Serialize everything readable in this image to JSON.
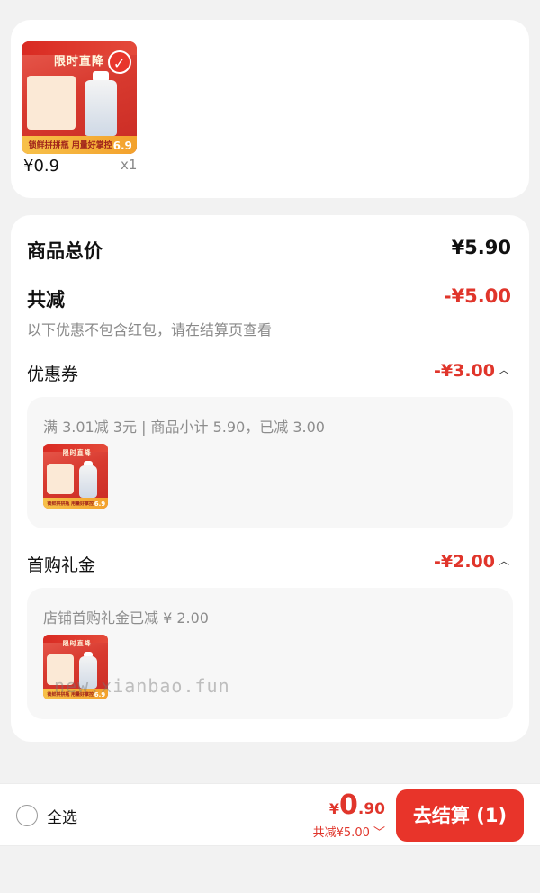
{
  "product": {
    "image": {
      "title": "限时直降",
      "footer": "锁鲜拼拼瓶 用量好掌控",
      "price_tag": "6.9"
    },
    "price": "¥0.9",
    "quantity": "x1"
  },
  "summary": {
    "total_label": "商品总价",
    "total_value": "¥5.90",
    "discount_label": "共减",
    "discount_value": "-¥5.00",
    "note": "以下优惠不包含红包，请在结算页查看",
    "coupon": {
      "label": "优惠券",
      "amount": "-¥3.00",
      "detail": "满 3.01减 3元 | 商品小计 5.90，已减 3.00"
    },
    "first_gift": {
      "label": "首购礼金",
      "amount": "-¥2.00",
      "detail": "店铺首购礼金已减 ¥ 2.00"
    }
  },
  "watermark": "new.xianbao.fun",
  "bottom_bar": {
    "select_all": "全选",
    "currency": "¥",
    "total_int": "0",
    "total_dec": ".90",
    "saved": "共减¥5.00",
    "checkout": "去结算 (1)"
  },
  "colors": {
    "accent": "#e0352b",
    "button": "#e8342a",
    "background": "#f2f2f2"
  },
  "icons": {
    "selected": "check-circle-icon",
    "expand": "chevron-up-icon",
    "saved_toggle": "chevron-down-icon"
  }
}
